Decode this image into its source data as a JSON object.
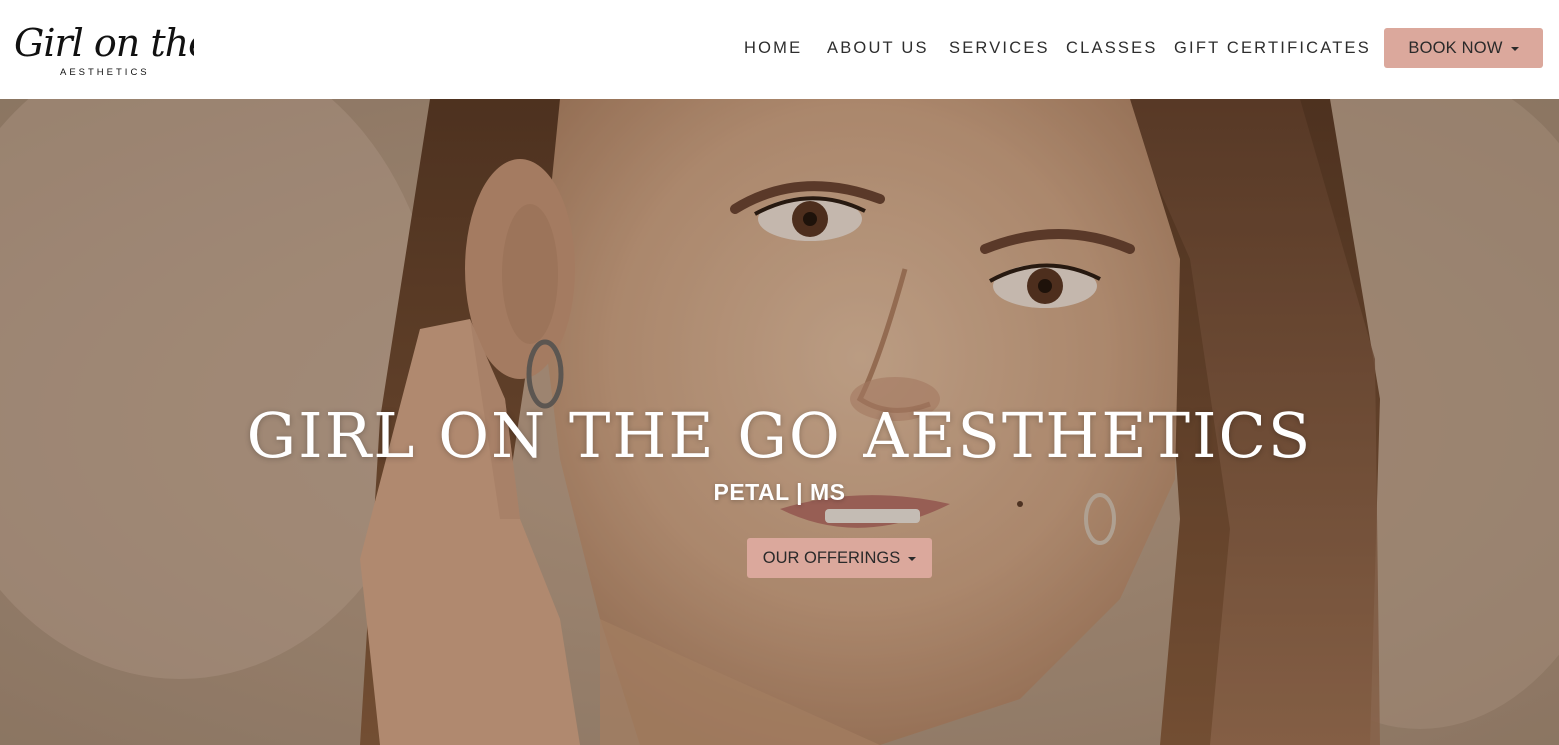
{
  "header": {
    "logo": {
      "script_text": "Girl on the go",
      "sub_text": "AESTHETICS"
    },
    "nav": [
      {
        "label": "HOME"
      },
      {
        "label": "ABOUT US"
      },
      {
        "label": "SERVICES"
      },
      {
        "label": "CLASSES"
      },
      {
        "label": "GIFT CERTIFICATES"
      }
    ],
    "book_button": {
      "label": "BOOK NOW",
      "icon": "caret-down-icon"
    }
  },
  "hero": {
    "title": "GIRL ON THE GO AESTHETICS",
    "subtitle": "PETAL | MS",
    "offerings_button": {
      "label": "OUR OFFERINGS",
      "icon": "caret-down-icon"
    }
  },
  "colors": {
    "accent": "#dba89c",
    "nav_text": "#2d2d2d",
    "hero_text": "#ffffff",
    "header_bg": "#ffffff"
  }
}
